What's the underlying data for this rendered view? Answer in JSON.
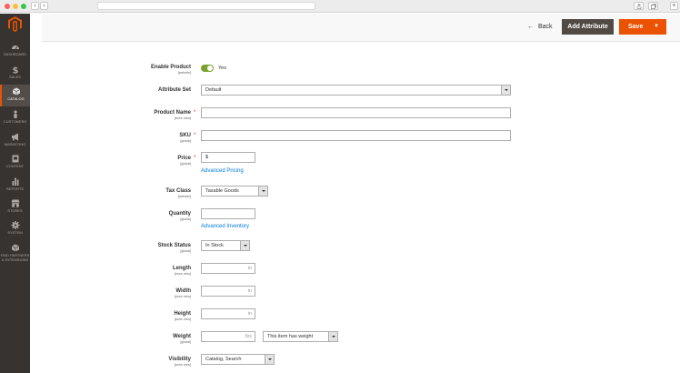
{
  "sidebar": {
    "items": [
      {
        "label": "Dashboard",
        "icon": "dashboard-icon"
      },
      {
        "label": "Sales",
        "icon": "dollar-icon"
      },
      {
        "label": "Catalog",
        "icon": "catalog-icon"
      },
      {
        "label": "Customers",
        "icon": "customer-icon"
      },
      {
        "label": "Marketing",
        "icon": "megaphone-icon"
      },
      {
        "label": "Content",
        "icon": "content-icon"
      },
      {
        "label": "Reports",
        "icon": "bar-chart-icon"
      },
      {
        "label": "Stores",
        "icon": "store-icon"
      },
      {
        "label": "System",
        "icon": "gear-icon"
      },
      {
        "label": "Find Partners",
        "label2": "& Extensions",
        "icon": "partners-icon"
      }
    ],
    "active": "Catalog",
    "accent": "#eb5202",
    "background": "#373330"
  },
  "header": {
    "back_label": "Back",
    "add_attribute_label": "Add Attribute",
    "save_label": "Save"
  },
  "form": {
    "enable_product": {
      "label": "Enable Product",
      "scope": "[website]",
      "value": "Yes",
      "checked": true
    },
    "attribute_set": {
      "label": "Attribute Set",
      "value": "Default"
    },
    "product_name": {
      "label": "Product Name",
      "scope": "[store view]",
      "value": "",
      "required": true
    },
    "sku": {
      "label": "SKU",
      "scope": "[global]",
      "value": "",
      "required": true
    },
    "price": {
      "label": "Price",
      "scope": "[global]",
      "currency": "$",
      "value": "",
      "required": true,
      "link": "Advanced Pricing"
    },
    "tax_class": {
      "label": "Tax Class",
      "scope": "[website]",
      "value": "Taxable Goods"
    },
    "quantity": {
      "label": "Quantity",
      "scope": "[global]",
      "value": "",
      "link": "Advanced Inventory"
    },
    "stock_status": {
      "label": "Stock Status",
      "scope": "[global]",
      "value": "In Stock"
    },
    "length": {
      "label": "Length",
      "scope": "[store view]",
      "unit": "in"
    },
    "width": {
      "label": "Width",
      "scope": "[store view]",
      "unit": "in"
    },
    "height": {
      "label": "Height",
      "scope": "[store view]",
      "unit": "in"
    },
    "weight": {
      "label": "Weight",
      "scope": "[global]",
      "unit": "lbs",
      "has_weight": "This item has weight"
    },
    "visibility": {
      "label": "Visibility",
      "scope": "[store view]",
      "value": "Catalog, Search"
    }
  },
  "colors": {
    "link": "#007bdb",
    "toggle_on": "#79a22e",
    "required": "#e22626",
    "primary_button": "#eb5202",
    "secondary_button": "#514943"
  }
}
